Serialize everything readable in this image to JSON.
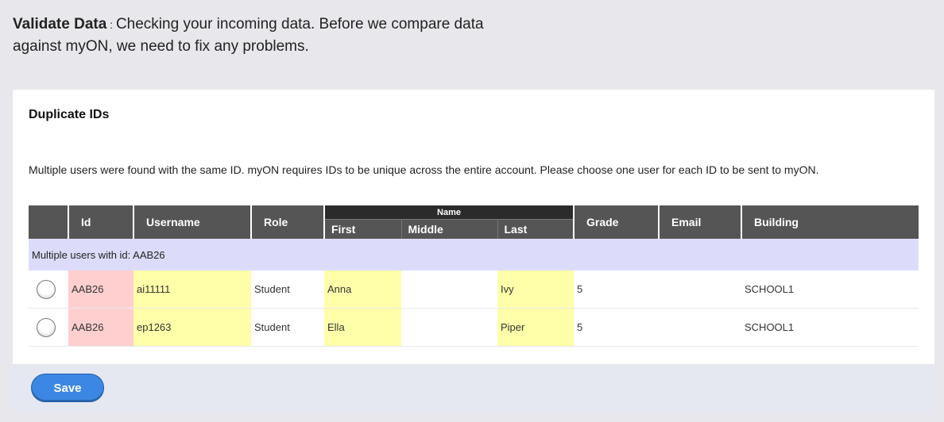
{
  "header": {
    "title": "Validate Data",
    "separator": " : ",
    "description": "Checking your incoming data. Before we compare data against myON, we need to fix any problems."
  },
  "panel": {
    "title": "Duplicate IDs",
    "description": "Multiple users were found with the same ID. myON requires IDs to be unique across the entire account. Please choose one user for each ID to be sent to myON."
  },
  "table": {
    "columns": {
      "id": "Id",
      "username": "Username",
      "role": "Role",
      "name": "Name",
      "first": "First",
      "middle": "Middle",
      "last": "Last",
      "grade": "Grade",
      "email": "Email",
      "building": "Building"
    },
    "group_label": "Multiple users with id: AAB26",
    "rows": [
      {
        "id": "AAB26",
        "username": "ai11111",
        "role": "Student",
        "first": "Anna",
        "middle": "",
        "last": "Ivy",
        "grade": "5",
        "email": "",
        "building": "SCHOOL1"
      },
      {
        "id": "AAB26",
        "username": "ep1263",
        "role": "Student",
        "first": "Ella",
        "middle": "",
        "last": "Piper",
        "grade": "5",
        "email": "",
        "building": "SCHOOL1"
      }
    ]
  },
  "footer": {
    "save_label": "Save"
  },
  "colors": {
    "accent": "#3b87e3",
    "duplicate_highlight": "#ffcfcf",
    "issue_highlight": "#ffffaa",
    "group_row": "#dcdcfa",
    "header_bg": "#555555"
  }
}
